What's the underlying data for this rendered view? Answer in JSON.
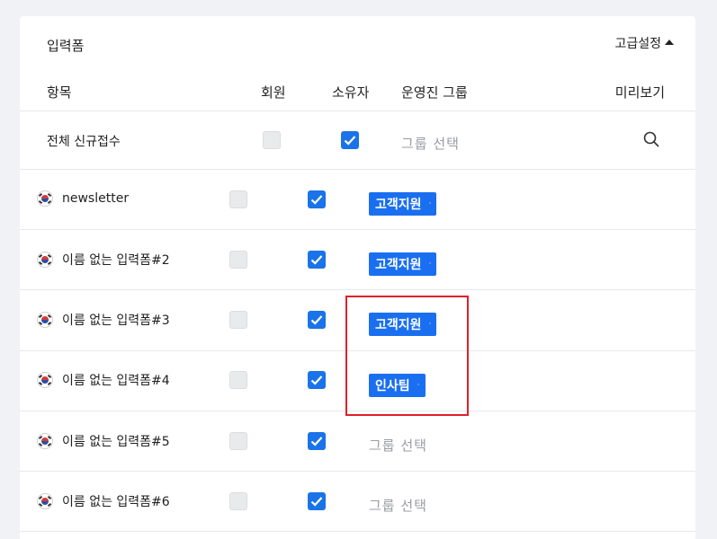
{
  "header": {
    "title": "입력폼",
    "advanced_label": "고급설정"
  },
  "columns": {
    "item": "항목",
    "member": "회원",
    "owner": "소유자",
    "admin_group": "운영진 그룹",
    "preview": "미리보기"
  },
  "all_row": {
    "label": "전체 신규접수",
    "member_checked": false,
    "owner_checked": true,
    "group_placeholder": "그룹 선택"
  },
  "rows": [
    {
      "label": "newsletter",
      "member_checked": false,
      "owner_checked": true,
      "group_tag": "고객지원",
      "group_placeholder": ""
    },
    {
      "label": "이름 없는 입력폼#2",
      "member_checked": false,
      "owner_checked": true,
      "group_tag": "고객지원",
      "group_placeholder": ""
    },
    {
      "label": "이름 없는 입력폼#3",
      "member_checked": false,
      "owner_checked": true,
      "group_tag": "고객지원",
      "group_placeholder": ""
    },
    {
      "label": "이름 없는 입력폼#4",
      "member_checked": false,
      "owner_checked": true,
      "group_tag": "인사팀",
      "group_placeholder": ""
    },
    {
      "label": "이름 없는 입력폼#5",
      "member_checked": false,
      "owner_checked": true,
      "group_tag": "",
      "group_placeholder": "그룹 선택"
    },
    {
      "label": "이름 없는 입력폼#6",
      "member_checked": false,
      "owner_checked": true,
      "group_tag": "",
      "group_placeholder": "그룹 선택"
    }
  ],
  "tag_remove_symbol": "·",
  "colors": {
    "accent": "#1a73e8",
    "tag_bg": "#1a6ff0",
    "highlight": "#e0202a"
  }
}
